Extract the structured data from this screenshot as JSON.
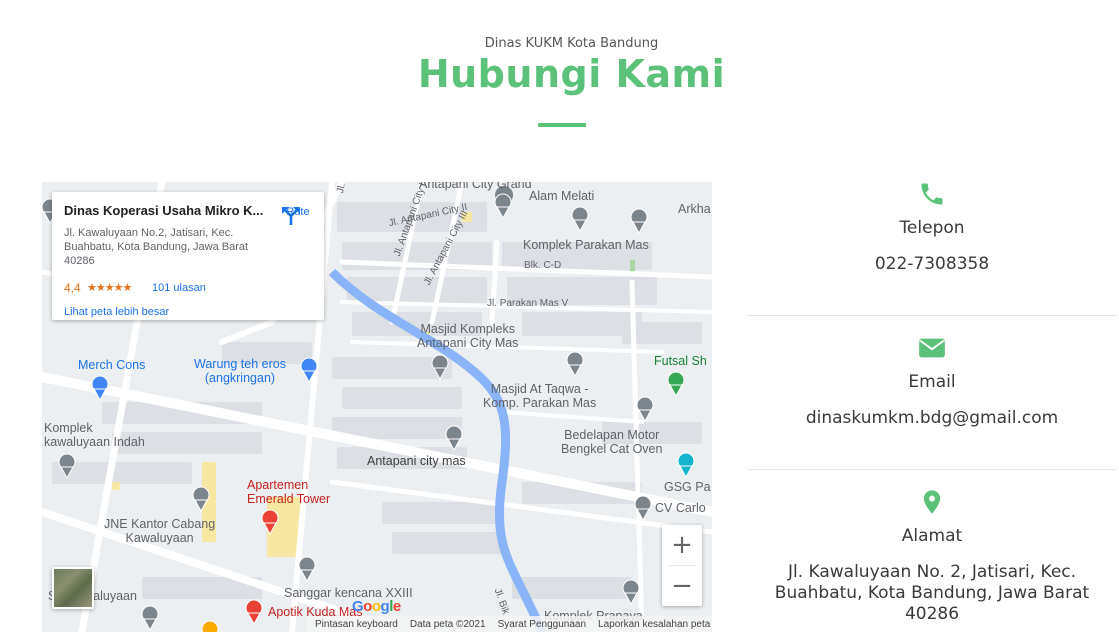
{
  "header": {
    "subtitle": "Dinas KUKM Kota Bandung",
    "title": "Hubungi Kami",
    "accent_color": "#5cc279"
  },
  "map": {
    "place_card": {
      "name": "Dinas Koperasi Usaha Mikro K...",
      "address": "Jl. Kawaluyaan No.2, Jatisari, Kec. Buahbatu, Kota Bandung, Jawa Barat 40286",
      "rating": "4,4",
      "stars": "★★★★★",
      "reviews": "101 ulasan",
      "larger_map": "Lihat peta lebih besar",
      "route_label": "Rute"
    },
    "labels": {
      "antapani_city_grand": "Antapani City Grand",
      "alam_melati": "Alam Melati",
      "arkha": "Arkha",
      "komplek_parakan_mas": "Komplek Parakan Mas",
      "blk_cd": "Blk. C-D",
      "jl_parakan_mas_v": "Jl. Parakan Mas V",
      "masjid_kompleks_1": "Masjid Kompleks",
      "masjid_kompleks_2": "Antapani City Mas",
      "futsal": "Futsal Sh",
      "merch_cons": "Merch Cons",
      "warung_1": "Warung teh eros",
      "warung_2": "(angkringan)",
      "masjid_taqwa_1": "Masjid At Taqwa -",
      "masjid_taqwa_2": "Komp. Parakan Mas",
      "komplek_kaw_1": "Komplek",
      "komplek_kaw_2": "kawaluyaan Indah",
      "bedelapan_1": "Bedelapan Motor",
      "bedelapan_2": "Bengkel Cat Oven",
      "antapani_city_mas": "Antapani city mas",
      "apartemen_1": "Apartemen",
      "apartemen_2": "Emerald Tower",
      "gsg": "GSG Pa",
      "cv_carlo": "CV Carlo",
      "jne_1": "JNE Kantor Cabang",
      "jne_2": "Kawaluyaan",
      "sanggar": "Sanggar kencana XXIII",
      "sd_kawaluyaan": "SD Kawaluyaan",
      "apotik": "Apotik Kuda Mas",
      "komplek_pranaya": "Komplek Pranaya",
      "road_antapani_city": "Jl. Antapani City",
      "road_antapani_city_ii": "Jl. Antapani City II",
      "road_antapani_city_iv": "Jl. Antapani City IV",
      "road_antapani_city_iii": "Jl. Antapani City III",
      "road_bik": "Jl. Bik"
    },
    "google": "Google",
    "attribution": {
      "keyboard": "Pintasan keyboard",
      "data": "Data peta ©2021",
      "terms": "Syarat Penggunaan",
      "report": "Laporkan kesalahan peta"
    },
    "zoom_in": "+",
    "zoom_out": "−"
  },
  "contacts": [
    {
      "icon": "phone-icon",
      "label": "Telepon",
      "value": "022-7308358"
    },
    {
      "icon": "envelope-icon",
      "label": "Email",
      "value": "dinaskumkm.bdg@gmail.com"
    },
    {
      "icon": "map-pin-icon",
      "label": "Alamat",
      "value_line1": "Jl. Kawaluyaan No. 2, Jatisari, Kec.",
      "value_line2": "Buahbatu, Kota Bandung, Jawa Barat",
      "value_line3": "40286"
    }
  ]
}
